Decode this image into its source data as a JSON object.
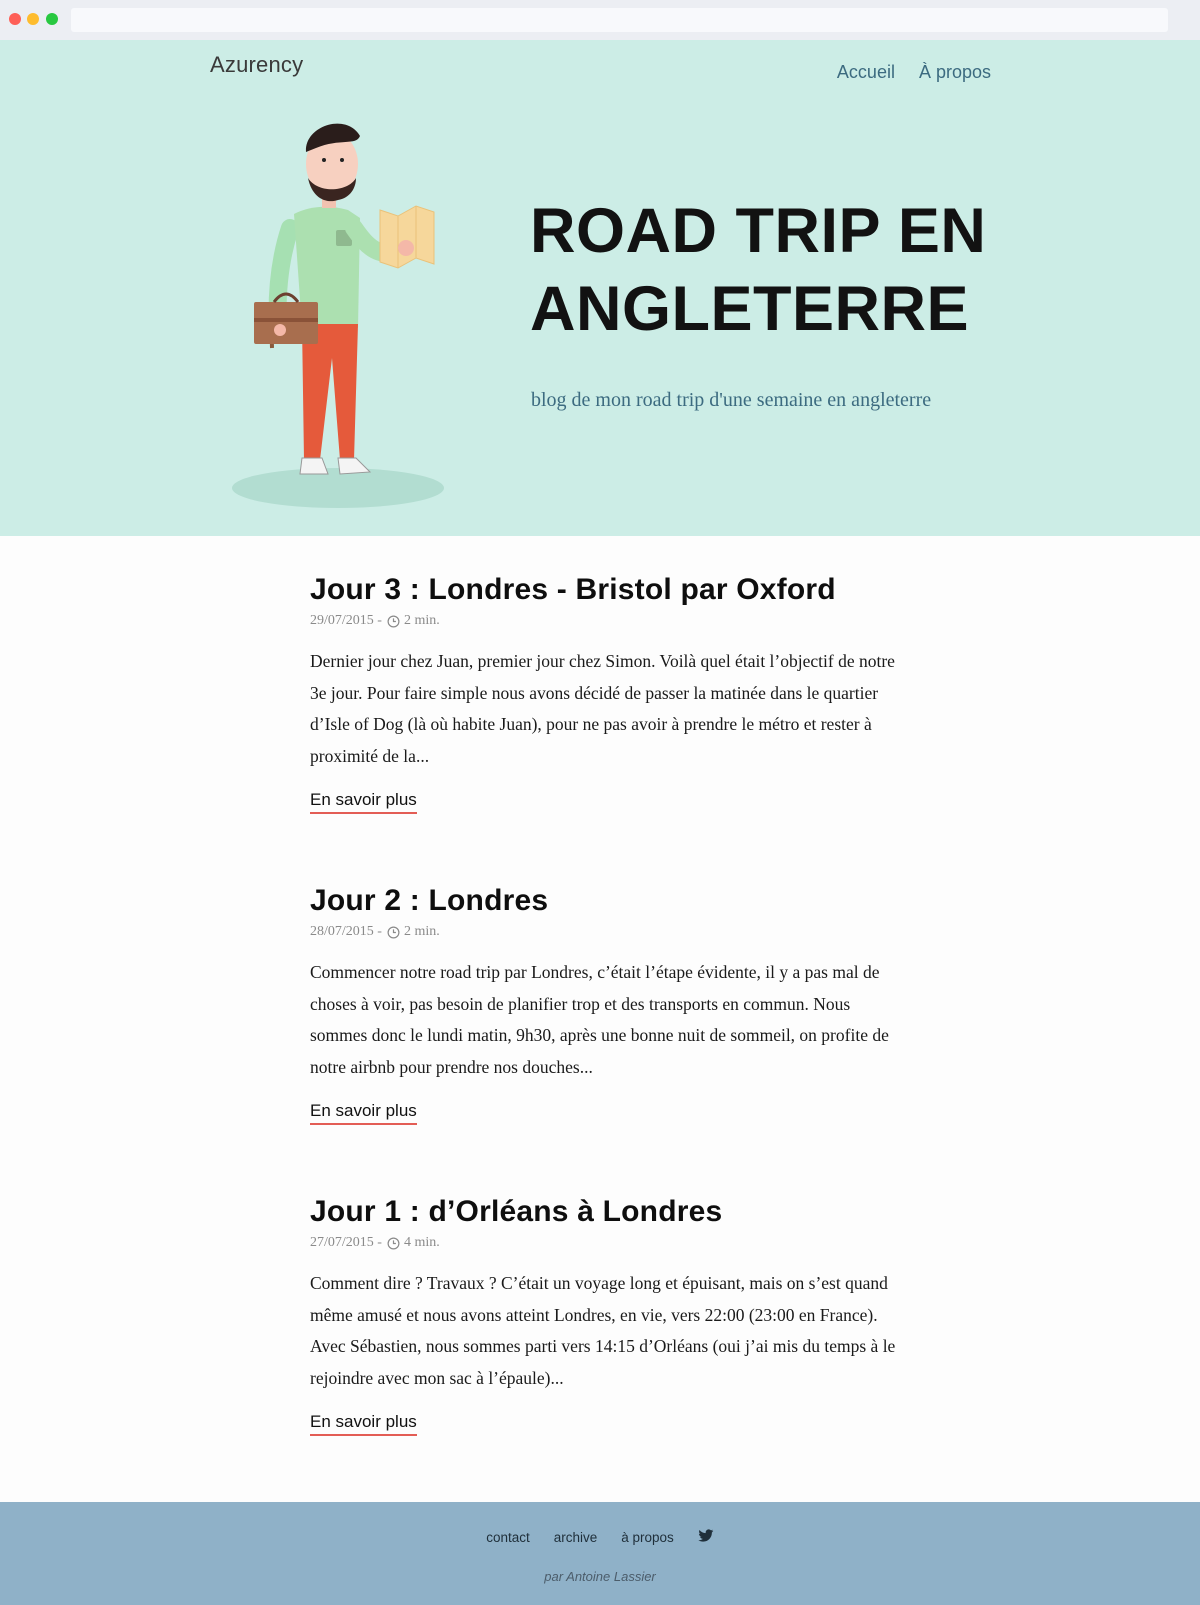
{
  "header": {
    "brand": "Azurency",
    "nav": [
      "Accueil",
      "À propos"
    ]
  },
  "hero": {
    "title": "ROAD TRIP EN ANGLETERRE",
    "subtitle": "blog de mon road trip d'une semaine en angleterre",
    "illustration_icon": "traveler-with-map-illustration"
  },
  "posts": [
    {
      "title": "Jour 3 : Londres - Bristol par Oxford",
      "date": "29/07/2015 -",
      "read_time": "2 min.",
      "excerpt": "Dernier jour chez Juan, premier jour chez Simon. Voilà quel était l’objectif de notre 3e jour. Pour faire simple nous avons décidé de passer la matinée dans le quartier d’Isle of Dog (là où habite Juan), pour ne pas avoir à prendre le métro et rester à proximité de la...",
      "link": "En savoir plus"
    },
    {
      "title": "Jour 2 : Londres",
      "date": "28/07/2015 -",
      "read_time": "2 min.",
      "excerpt": "Commencer notre road trip par Londres, c’était l’étape évidente, il y a pas mal de choses à voir, pas besoin de planifier trop et des transports en commun. Nous sommes donc le lundi matin, 9h30, après une bonne nuit de sommeil, on profite de notre airbnb pour prendre nos douches...",
      "link": "En savoir plus"
    },
    {
      "title": "Jour 1 : d’Orléans à Londres",
      "date": "27/07/2015 -",
      "read_time": "4 min.",
      "excerpt": "Comment dire ? Travaux ? C’était un voyage long et épuisant, mais on s’est quand même amusé et nous avons atteint Londres, en vie, vers 22:00 (23:00 en France). Avec Sébastien, nous sommes parti vers 14:15 d’Orléans (oui j’ai mis du temps à le rejoindre avec mon sac à l’épaule)...",
      "link": "En savoir plus"
    }
  ],
  "footer": {
    "links": [
      "contact",
      "archive",
      "à propos"
    ],
    "social_icon": "twitter-icon",
    "credit": "par Antoine Lassier"
  },
  "colors": {
    "hero_bg": "#ccede6",
    "footer_bg": "#8fb1c8",
    "accent_underline": "#e35d55",
    "link_blue": "#3c6b80"
  }
}
